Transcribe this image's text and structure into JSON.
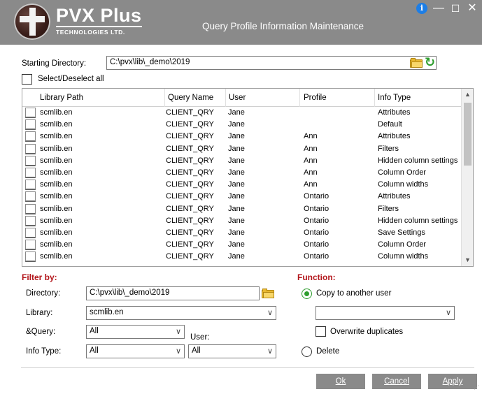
{
  "window": {
    "title": "Query Profile Information Maintenance",
    "logo_main": "PVX Plus",
    "logo_sub": "TECHNOLOGIES LTD.",
    "controls": {
      "info": "i",
      "minimize": "—",
      "maximize": "☐",
      "close": "✕"
    }
  },
  "starting_directory": {
    "label": "Starting Directory:",
    "value": "C:\\pvx\\lib\\_demo\\2019"
  },
  "select_all_label": "Select/Deselect all",
  "grid": {
    "columns": [
      "Library Path",
      "Query Name",
      "User",
      "Profile",
      "Info Type"
    ],
    "rows": [
      [
        "scmlib.en",
        "CLIENT_QRY",
        "Jane",
        "",
        "Attributes"
      ],
      [
        "scmlib.en",
        "CLIENT_QRY",
        "Jane",
        "",
        "Default"
      ],
      [
        "scmlib.en",
        "CLIENT_QRY",
        "Jane",
        "Ann",
        "Attributes"
      ],
      [
        "scmlib.en",
        "CLIENT_QRY",
        "Jane",
        "Ann",
        "Filters"
      ],
      [
        "scmlib.en",
        "CLIENT_QRY",
        "Jane",
        "Ann",
        "Hidden column settings"
      ],
      [
        "scmlib.en",
        "CLIENT_QRY",
        "Jane",
        "Ann",
        "Column Order"
      ],
      [
        "scmlib.en",
        "CLIENT_QRY",
        "Jane",
        "Ann",
        "Column widths"
      ],
      [
        "scmlib.en",
        "CLIENT_QRY",
        "Jane",
        "Ontario",
        "Attributes"
      ],
      [
        "scmlib.en",
        "CLIENT_QRY",
        "Jane",
        "Ontario",
        "Filters"
      ],
      [
        "scmlib.en",
        "CLIENT_QRY",
        "Jane",
        "Ontario",
        "Hidden column settings"
      ],
      [
        "scmlib.en",
        "CLIENT_QRY",
        "Jane",
        "Ontario",
        "Save Settings"
      ],
      [
        "scmlib.en",
        "CLIENT_QRY",
        "Jane",
        "Ontario",
        "Column Order"
      ],
      [
        "scmlib.en",
        "CLIENT_QRY",
        "Jane",
        "Ontario",
        "Column widths"
      ]
    ]
  },
  "filter": {
    "title": "Filter by:",
    "directory_label": "Directory:",
    "directory_value": "C:\\pvx\\lib\\_demo\\2019",
    "library_label": "Library:",
    "library_value": "scmlib.en",
    "query_label": "&Query:",
    "query_value": "All",
    "user_label": "User:",
    "user_value": "All",
    "info_type_label": "Info Type:",
    "info_type_value": "All"
  },
  "function": {
    "title": "Function:",
    "copy_label": "Copy to another user",
    "target_user_value": "",
    "overwrite_label": "Overwrite duplicates",
    "delete_label": "Delete",
    "selected": "copy"
  },
  "buttons": {
    "ok": "Ok",
    "cancel": "Cancel",
    "apply": "Apply"
  },
  "colors": {
    "titlebar": "#8a8a8a",
    "section_title": "#b3161b",
    "accent_green": "#2e9d2e",
    "button_bg": "#8a8a8a"
  }
}
